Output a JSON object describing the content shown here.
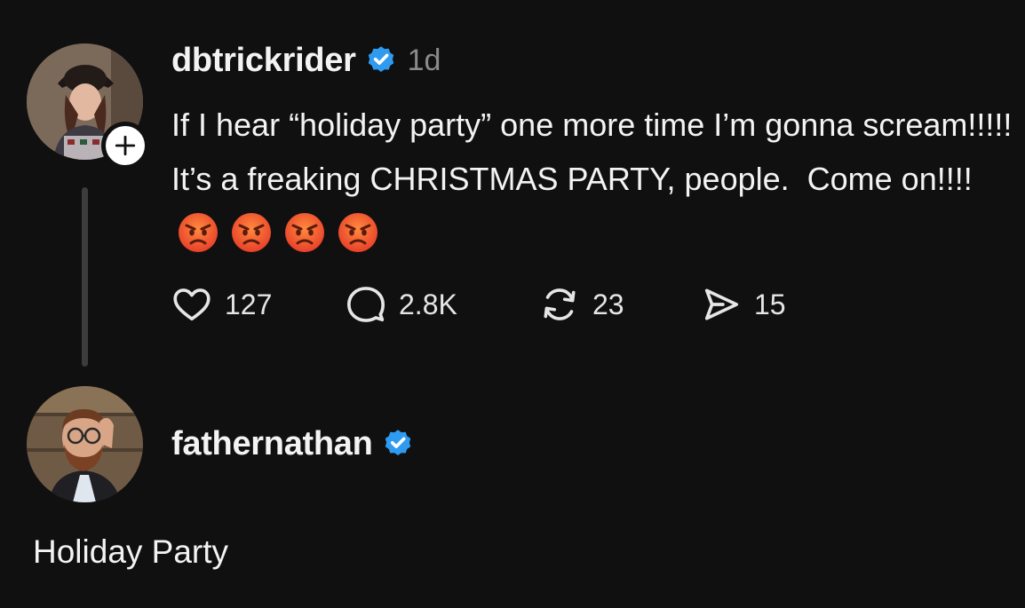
{
  "post": {
    "username": "dbtrickrider",
    "timestamp": "1d",
    "text": "If I hear “holiday party” one more time I’m gonna scream!!!!! It’s a freaking CHRISTMAS PARTY, people.  Come on!!!!",
    "emoji_count": 4,
    "emoji_icon": "angry-face-icon",
    "stats": {
      "likes": "127",
      "replies": "2.8K",
      "reposts": "23",
      "shares": "15"
    }
  },
  "reply": {
    "username": "fathernathan",
    "text": "Holiday Party"
  },
  "colors": {
    "background": "#101010",
    "text": "#f3f3f3",
    "muted": "#8a8a8a",
    "verified": "#2f9bf0",
    "thread_line": "#3c3c3c"
  },
  "icons": {
    "like": "heart-icon",
    "reply": "comment-bubble-icon",
    "repost": "repost-icon",
    "share": "send-icon",
    "verified": "verified-badge-icon",
    "follow": "plus-icon"
  }
}
